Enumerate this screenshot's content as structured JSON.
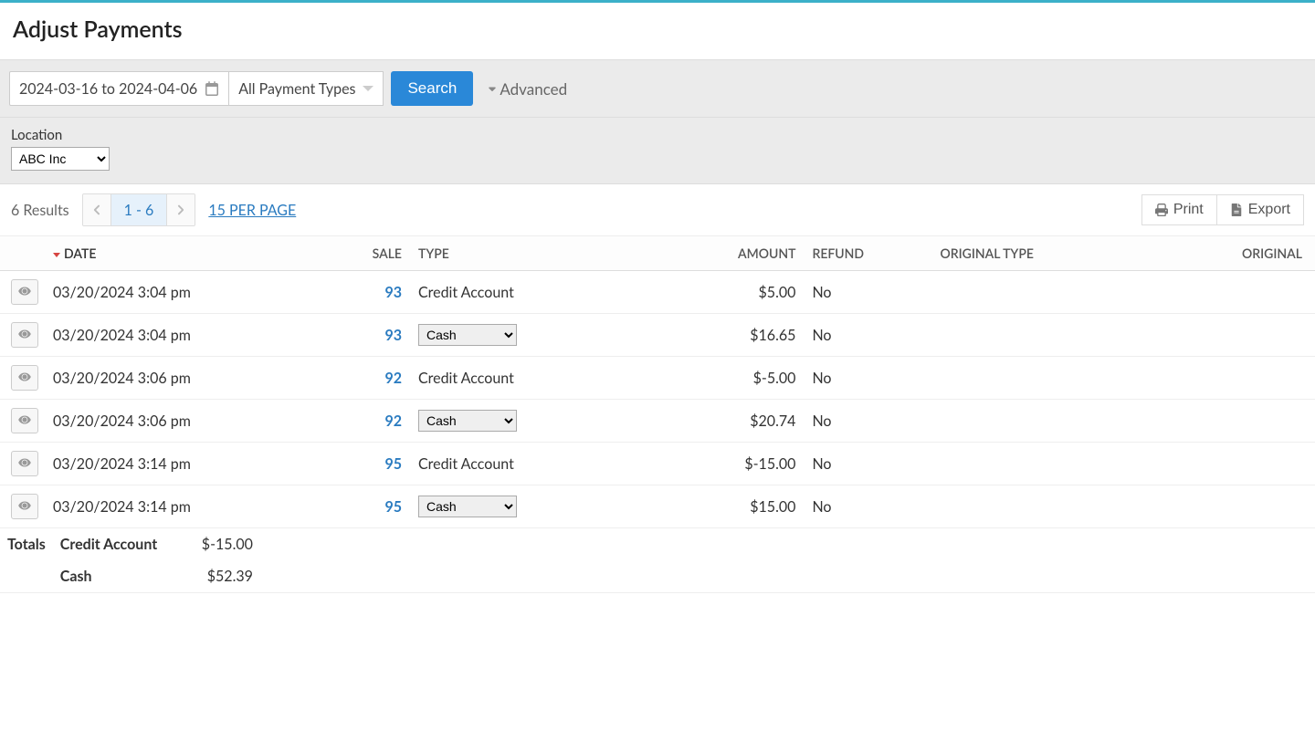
{
  "page": {
    "title": "Adjust Payments"
  },
  "filters": {
    "date_range": "2024-03-16 to 2024-04-06",
    "payment_type": "All Payment Types",
    "search_label": "Search",
    "advanced_label": "Advanced",
    "location_label": "Location",
    "location_value": "ABC Inc"
  },
  "results": {
    "count_text": "6 Results",
    "page_range": "1 - 6",
    "per_page_text": "15 PER PAGE",
    "print_label": "Print",
    "export_label": "Export"
  },
  "columns": {
    "date": "DATE",
    "sale": "SALE",
    "type": "TYPE",
    "amount": "AMOUNT",
    "refund": "REFUND",
    "original_type": "ORIGINAL TYPE",
    "original": "ORIGINAL"
  },
  "rows": [
    {
      "date": "03/20/2024 3:04 pm",
      "sale": "93",
      "type": "Credit Account",
      "type_editable": false,
      "amount": "$5.00",
      "refund": "No"
    },
    {
      "date": "03/20/2024 3:04 pm",
      "sale": "93",
      "type": "Cash",
      "type_editable": true,
      "amount": "$16.65",
      "refund": "No"
    },
    {
      "date": "03/20/2024 3:06 pm",
      "sale": "92",
      "type": "Credit Account",
      "type_editable": false,
      "amount": "$-5.00",
      "refund": "No"
    },
    {
      "date": "03/20/2024 3:06 pm",
      "sale": "92",
      "type": "Cash",
      "type_editable": true,
      "amount": "$20.74",
      "refund": "No"
    },
    {
      "date": "03/20/2024 3:14 pm",
      "sale": "95",
      "type": "Credit Account",
      "type_editable": false,
      "amount": "$-15.00",
      "refund": "No"
    },
    {
      "date": "03/20/2024 3:14 pm",
      "sale": "95",
      "type": "Cash",
      "type_editable": true,
      "amount": "$15.00",
      "refund": "No"
    }
  ],
  "totals": {
    "label": "Totals",
    "lines": [
      {
        "type": "Credit Account",
        "amount": "$-15.00"
      },
      {
        "type": "Cash",
        "amount": "$52.39"
      }
    ]
  }
}
